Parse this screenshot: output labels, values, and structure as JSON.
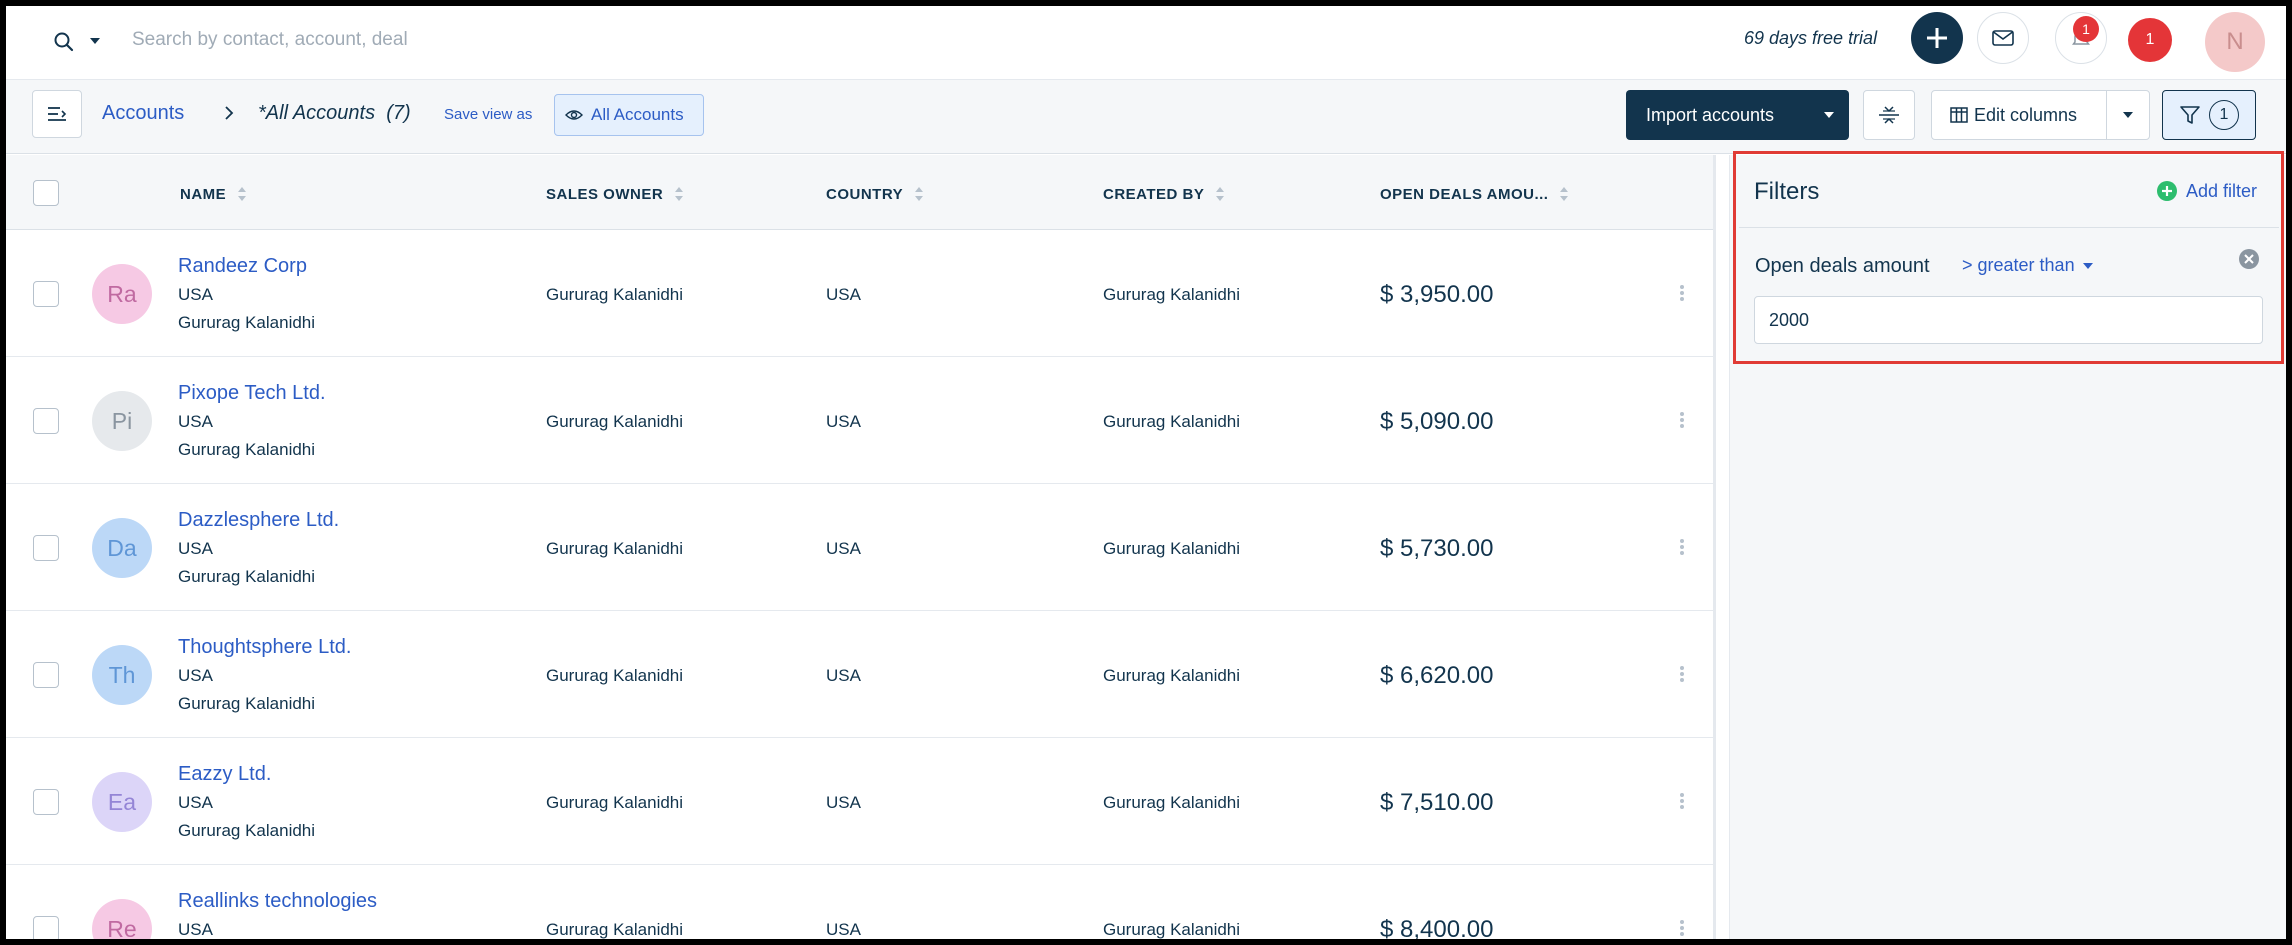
{
  "header": {
    "search_placeholder": "Search by contact, account, deal",
    "trial_text": "69 days free trial",
    "notification_count": "1",
    "alert_count": "1",
    "user_initial": "N"
  },
  "subheader": {
    "breadcrumb_root": "Accounts",
    "view_name": "*All Accounts  (7)",
    "save_view_label": "Save view as",
    "view_chip_label": "All Accounts",
    "import_label": "Import accounts",
    "edit_columns_label": "Edit columns",
    "filter_count": "1"
  },
  "table": {
    "columns": [
      "NAME",
      "SALES OWNER",
      "COUNTRY",
      "CREATED BY",
      "OPEN DEALS AMOU..."
    ],
    "rows": [
      {
        "initials": "Ra",
        "name": "Randeez Corp",
        "country_line": "USA",
        "owner_line": "Gururag Kalanidhi",
        "sales_owner": "Gururag Kalanidhi",
        "country": "USA",
        "created_by": "Gururag Kalanidhi",
        "amount": "$ 3,950.00",
        "avatar_bg": "#f6c9e4",
        "avatar_fg": "#c06aa1"
      },
      {
        "initials": "Pi",
        "name": "Pixope Tech Ltd.",
        "country_line": "USA",
        "owner_line": "Gururag Kalanidhi",
        "sales_owner": "Gururag Kalanidhi",
        "country": "USA",
        "created_by": "Gururag Kalanidhi",
        "amount": "$ 5,090.00",
        "avatar_bg": "#e6e9ec",
        "avatar_fg": "#8a95a0"
      },
      {
        "initials": "Da",
        "name": "Dazzlesphere Ltd.",
        "country_line": "USA",
        "owner_line": "Gururag Kalanidhi",
        "sales_owner": "Gururag Kalanidhi",
        "country": "USA",
        "created_by": "Gururag Kalanidhi",
        "amount": "$ 5,730.00",
        "avatar_bg": "#bcd8f7",
        "avatar_fg": "#5f96d6"
      },
      {
        "initials": "Th",
        "name": "Thoughtsphere Ltd.",
        "country_line": "USA",
        "owner_line": "Gururag Kalanidhi",
        "sales_owner": "Gururag Kalanidhi",
        "country": "USA",
        "created_by": "Gururag Kalanidhi",
        "amount": "$ 6,620.00",
        "avatar_bg": "#bcd8f7",
        "avatar_fg": "#5f96d6"
      },
      {
        "initials": "Ea",
        "name": "Eazzy Ltd.",
        "country_line": "USA",
        "owner_line": "Gururag Kalanidhi",
        "sales_owner": "Gururag Kalanidhi",
        "country": "USA",
        "created_by": "Gururag Kalanidhi",
        "amount": "$ 7,510.00",
        "avatar_bg": "#dcd5f8",
        "avatar_fg": "#9485d6"
      },
      {
        "initials": "Re",
        "name": "Reallinks technologies",
        "country_line": "USA",
        "owner_line": "",
        "sales_owner": "Gururag Kalanidhi",
        "country": "USA",
        "created_by": "Gururag Kalanidhi",
        "amount": "$ 8,400.00",
        "avatar_bg": "#f6c9e4",
        "avatar_fg": "#c06aa1"
      }
    ]
  },
  "filters": {
    "title": "Filters",
    "add_filter_label": "Add filter",
    "field_label": "Open deals amount",
    "operator_label": "> greater than",
    "value": "2000"
  },
  "colors": {
    "brand_dark": "#12344d",
    "link_blue": "#2c5cc5",
    "alert_red": "#e43538",
    "highlight_border": "#e03b35",
    "add_green": "#2dbd6e"
  },
  "icons": [
    "search-icon",
    "chevron-down-icon",
    "plus-icon",
    "mail-icon",
    "bell-icon",
    "menu-toggle-icon",
    "chevron-right-icon",
    "eye-icon",
    "density-icon",
    "columns-icon",
    "filter-icon",
    "sort-icon",
    "kebab-icon",
    "add-circle-icon",
    "close-circle-icon"
  ]
}
